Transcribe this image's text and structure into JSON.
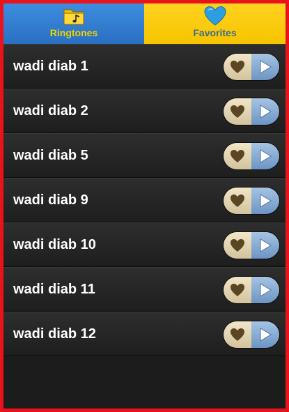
{
  "tabs": [
    {
      "label": "Ringtones",
      "icon": "music-folder-icon",
      "color": "#2a6fc2"
    },
    {
      "label": "Favorites",
      "icon": "heart-icon",
      "color": "#f6c400"
    }
  ],
  "ringtones": [
    {
      "title": "wadi diab 1"
    },
    {
      "title": "wadi diab 2"
    },
    {
      "title": "wadi diab 5"
    },
    {
      "title": "wadi diab 9"
    },
    {
      "title": "wadi diab 10"
    },
    {
      "title": "wadi diab 11"
    },
    {
      "title": "wadi diab 12"
    }
  ],
  "row_controls": {
    "favorite_icon": "heart-icon",
    "play_icon": "play-icon"
  },
  "colors": {
    "border": "#e8131b",
    "heart_fill": "#5a4622",
    "favorites_heart": "#2b9fe0"
  }
}
